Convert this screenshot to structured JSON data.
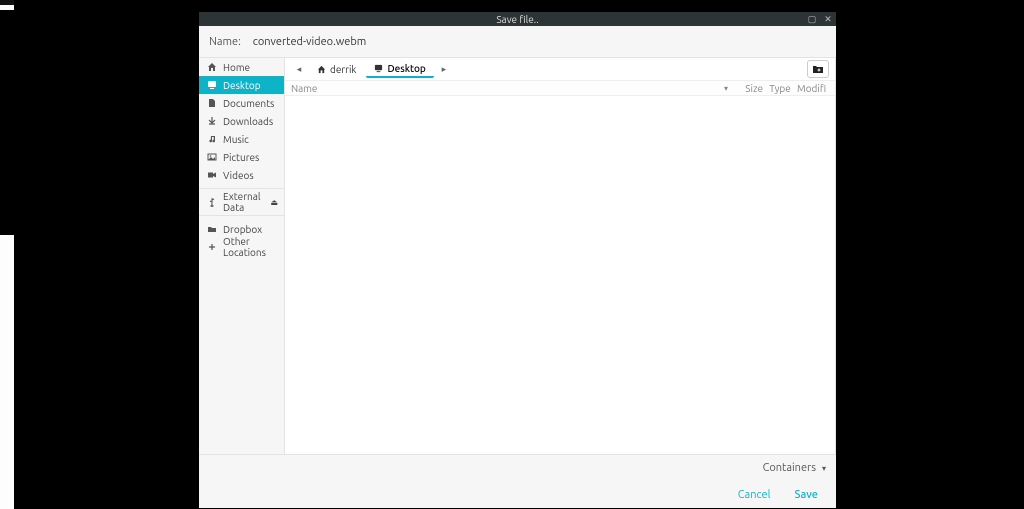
{
  "title": "Save file..",
  "name_label": "Name:",
  "filename": "converted-video.webm",
  "sidebar": {
    "items": [
      {
        "label": "Home",
        "icon": "home-icon"
      },
      {
        "label": "Desktop",
        "icon": "desktop-icon",
        "selected": true
      },
      {
        "label": "Documents",
        "icon": "documents-icon"
      },
      {
        "label": "Downloads",
        "icon": "downloads-icon"
      },
      {
        "label": "Music",
        "icon": "music-icon"
      },
      {
        "label": "Pictures",
        "icon": "pictures-icon"
      },
      {
        "label": "Videos",
        "icon": "videos-icon"
      }
    ],
    "volumes": [
      {
        "label": "External Data",
        "icon": "usb-icon",
        "ejectable": true
      }
    ],
    "remotes": [
      {
        "label": "Dropbox",
        "icon": "folder-icon"
      },
      {
        "label": "Other Locations",
        "icon": "plus-icon"
      }
    ]
  },
  "breadcrumb": [
    {
      "label": "derrik",
      "icon": "home-icon"
    },
    {
      "label": "Desktop",
      "icon": "desktop-icon",
      "active": true
    }
  ],
  "columns": {
    "name": "Name",
    "size": "Size",
    "type": "Type",
    "modified": "Modifi"
  },
  "filter_label": "Containers",
  "buttons": {
    "cancel": "Cancel",
    "save": "Save"
  },
  "colors": {
    "accent": "#0fb3c8",
    "titlebar": "#2d3436"
  }
}
